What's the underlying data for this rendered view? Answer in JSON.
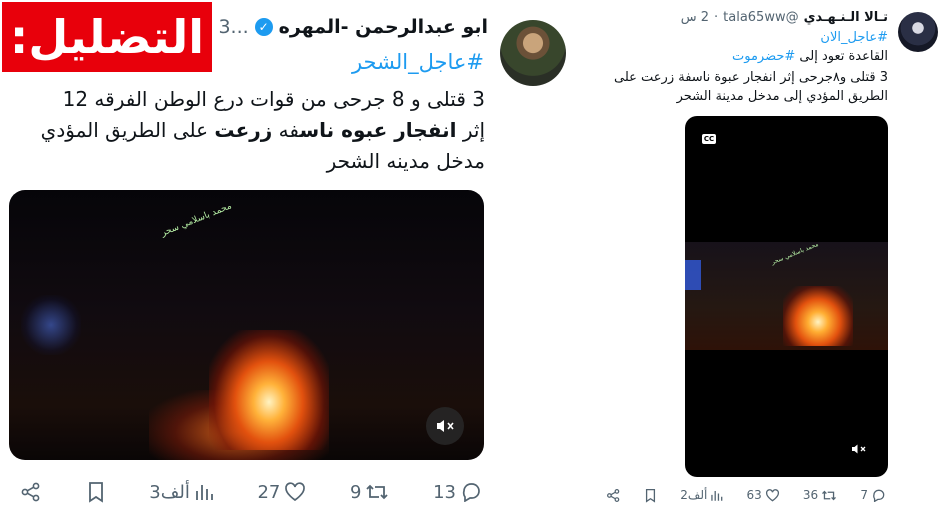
{
  "label_badge": "التضليل:",
  "left_tweet": {
    "author_name": "ابو عبدالرحمن -المهره",
    "author_more": "...3",
    "hashtag": "#عاجل_الشحر",
    "body_line1": "3 قتلى و 8 جرحى من قوات درع الوطن الفرقه 12",
    "body_line2_part1": "إثر ",
    "body_line2_bold1": "انفجار عبوه ناس",
    "body_line2_part2": "فه ",
    "body_line2_bold2": "زرعت",
    "body_line2_part3": " على الطريق المؤدي",
    "body_line3": "مدخل مدينه الشحر",
    "video_watermark": "محمد باسلامي سحر",
    "actions": {
      "replies": "13",
      "reposts": "9",
      "likes": "27",
      "views": "3ألف"
    }
  },
  "right_tweet": {
    "author_name": "تـالا الـنـهـدي",
    "handle": "@tala65ww",
    "time": "2 س",
    "hashtag1": "#عاجل_الان",
    "line2_text": "القاعدة تعود إلى ",
    "line2_tag": "#حضرموت",
    "body": "3 قتلى و٨جرحى إثر انفجار عبوة ناسفة زرعت على الطريق المؤدي إلى مدخل مدينة الشحر",
    "cc_label": "CC",
    "actions": {
      "replies": "7",
      "reposts": "36",
      "likes": "63",
      "views": "2ألف"
    }
  },
  "colors": {
    "accent": "#1d9bf0",
    "badge": "#e8000b",
    "muted": "#536471"
  }
}
